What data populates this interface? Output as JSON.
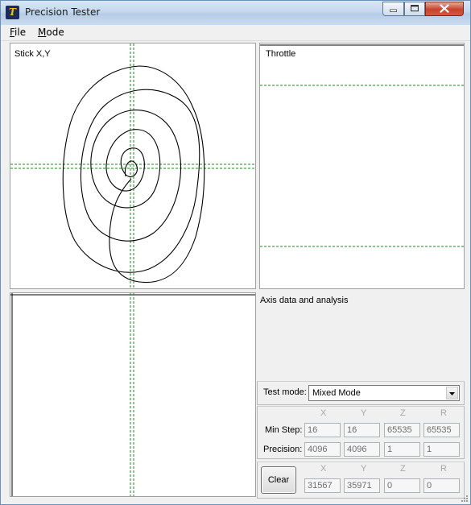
{
  "window": {
    "title": "Precision Tester",
    "icon": "app-logo-icon"
  },
  "menu": [
    {
      "label": "File",
      "accel": "F",
      "rest": "ile"
    },
    {
      "label": "Mode",
      "accel": "M",
      "rest": "ode"
    }
  ],
  "panels": {
    "stick_label": "Stick X,Y",
    "throttle_label": "Throttle",
    "analysis_label": "Axis data and analysis"
  },
  "controls": {
    "test_mode_label": "Test mode:",
    "test_mode_value": "Mixed Mode",
    "axis_headers": [
      "X",
      "Y",
      "Z",
      "R"
    ],
    "min_step_label": "Min Step:",
    "min_step_values": [
      "16",
      "16",
      "65535",
      "65535"
    ],
    "precision_label": "Precision:",
    "precision_values": [
      "4096",
      "4096",
      "1",
      "1"
    ],
    "clear_label": "Clear",
    "current_values": [
      "31567",
      "35971",
      "0",
      "0"
    ]
  },
  "colors": {
    "crosshair": "#1e8a1e",
    "trace": "#000000",
    "title_bar": "#c5d8ee"
  }
}
